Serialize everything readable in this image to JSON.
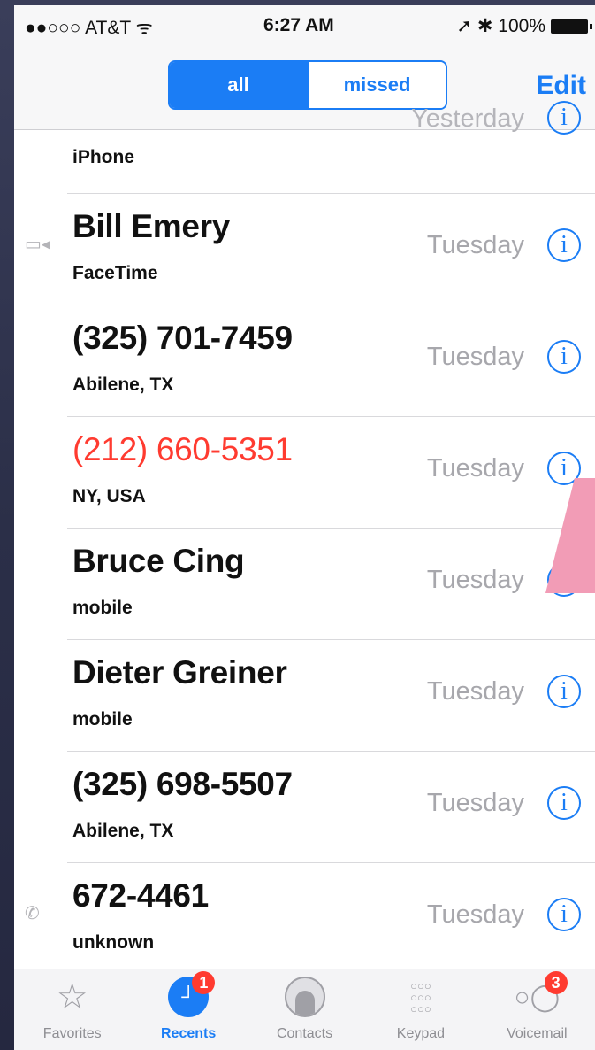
{
  "status_bar": {
    "carrier": "●●○○○ AT&T ᯤ",
    "time": "6:27 AM",
    "indicators": "➚ ✱ 100%"
  },
  "nav": {
    "segments": [
      "all",
      "missed"
    ],
    "selected_segment": "all",
    "edit_label": "Edit"
  },
  "calls": [
    {
      "name": "",
      "type": "iPhone",
      "when": "Yesterday",
      "missed": false,
      "icon": ""
    },
    {
      "name": "Bill Emery",
      "type": "FaceTime",
      "when": "Tuesday",
      "missed": false,
      "icon": "facetime-icon"
    },
    {
      "name": "(325) 701-7459",
      "type": "Abilene, TX",
      "when": "Tuesday",
      "missed": false,
      "icon": ""
    },
    {
      "name": "(212) 660-5351",
      "type": "NY, USA",
      "when": "Tuesday",
      "missed": true,
      "icon": ""
    },
    {
      "name": "Bruce Cing",
      "type": "mobile",
      "when": "Tuesday",
      "missed": false,
      "icon": ""
    },
    {
      "name": "Dieter Greiner",
      "type": "mobile",
      "when": "Tuesday",
      "missed": false,
      "icon": ""
    },
    {
      "name": "(325) 698-5507",
      "type": "Abilene, TX",
      "when": "Tuesday",
      "missed": false,
      "icon": ""
    },
    {
      "name": "672-4461",
      "type": "unknown",
      "when": "Tuesday",
      "missed": false,
      "icon": "outgoing-call-icon"
    }
  ],
  "info_glyph": "i",
  "tabs": [
    {
      "label": "Favorites",
      "icon": "star-icon",
      "badge": ""
    },
    {
      "label": "Recents",
      "icon": "clock-icon",
      "badge": "1"
    },
    {
      "label": "Contacts",
      "icon": "contact-icon",
      "badge": ""
    },
    {
      "label": "Keypad",
      "icon": "keypad-icon",
      "badge": ""
    },
    {
      "label": "Voicemail",
      "icon": "voicemail-icon",
      "badge": "3"
    }
  ],
  "active_tab": "Recents",
  "colors": {
    "accent": "#1b7df5",
    "missed": "#ff3b30",
    "pointer": "#f29cb6"
  }
}
